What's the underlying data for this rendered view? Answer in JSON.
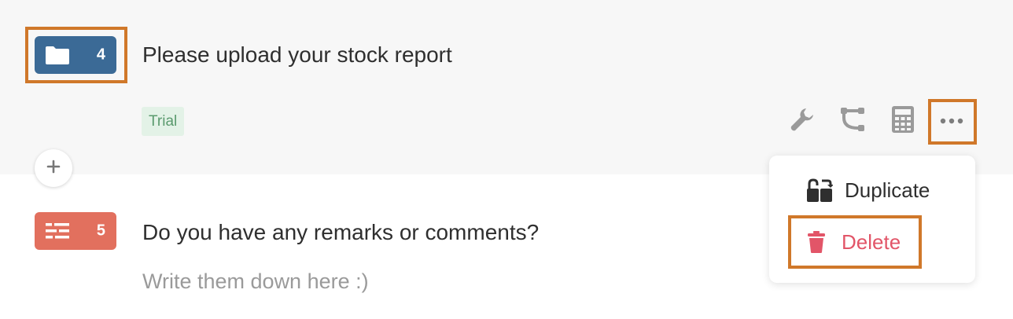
{
  "questions": [
    {
      "number": "4",
      "type_icon": "folder-icon",
      "title": "Please upload your stock report",
      "tag": "Trial",
      "badge_color": "#3b6a96"
    },
    {
      "number": "5",
      "type_icon": "text-lines-icon",
      "title": "Do you have any remarks or comments?",
      "placeholder": "Write them down here :)",
      "badge_color": "#e2705e"
    }
  ],
  "toolbar": {
    "icons": [
      "wrench-icon",
      "branch-icon",
      "calculator-icon",
      "more-icon"
    ]
  },
  "menu": {
    "duplicate_label": "Duplicate",
    "delete_label": "Delete"
  },
  "colors": {
    "highlight": "#d0782a",
    "delete": "#e25568",
    "tag_bg": "#e3f2e7",
    "tag_text": "#5a9a6e"
  }
}
